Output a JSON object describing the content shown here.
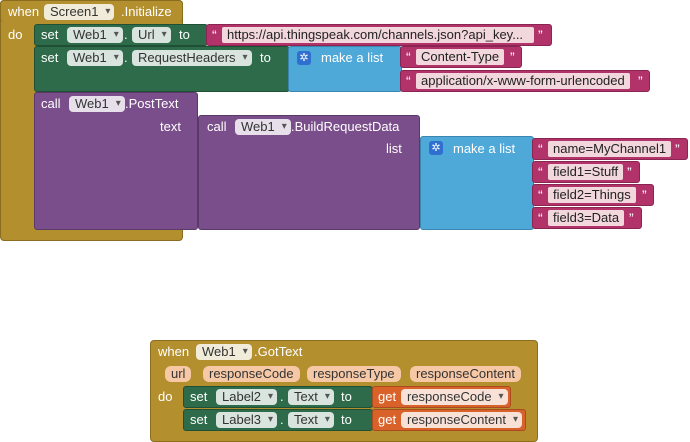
{
  "init": {
    "when": "when",
    "component": "Screen1",
    "event": ".Initialize",
    "do": "do",
    "set1": {
      "set": "set",
      "comp": "Web1",
      "dot": ".",
      "prop": "Url",
      "to": "to",
      "url": "https://api.thingspeak.com/channels.json?api_key..."
    },
    "set2": {
      "set": "set",
      "comp": "Web1",
      "dot": ".",
      "prop": "RequestHeaders",
      "to": "to",
      "make_list": "make a list",
      "items": [
        "Content-Type",
        "application/x-www-form-urlencoded"
      ]
    },
    "call": {
      "call": "call",
      "comp": "Web1",
      "method": ".PostText",
      "text_label": "text",
      "inner_call": "call",
      "inner_comp": "Web1",
      "inner_method": ".BuildRequestData",
      "list_label": "list",
      "make_list": "make a list",
      "items": [
        "name=MyChannel1",
        "field1=Stuff",
        "field2=Things",
        "field3=Data"
      ]
    }
  },
  "gottext": {
    "when": "when",
    "component": "Web1",
    "event": ".GotText",
    "params": [
      "url",
      "responseCode",
      "responseType",
      "responseContent"
    ],
    "do": "do",
    "rows": [
      {
        "set": "set",
        "comp": "Label2",
        "dot": ".",
        "prop": "Text",
        "to": "to",
        "get": "get",
        "var": "responseCode"
      },
      {
        "set": "set",
        "comp": "Label3",
        "dot": ".",
        "prop": "Text",
        "to": "to",
        "get": "get",
        "var": "responseContent"
      }
    ]
  }
}
